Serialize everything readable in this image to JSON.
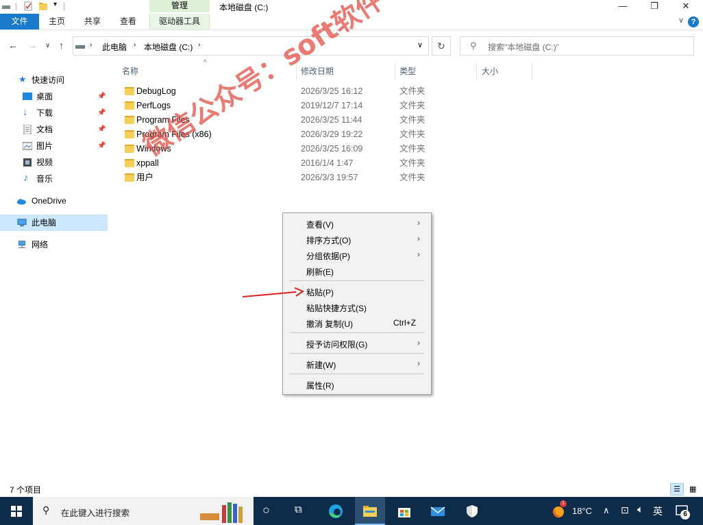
{
  "window": {
    "title": "本地磁盘 (C:)",
    "manage_tab": "管理",
    "controls": {
      "minimize": "—",
      "maximize": "❐",
      "close": "✕"
    }
  },
  "ribbon": {
    "tabs": [
      {
        "label": "文件",
        "active": true
      },
      {
        "label": "主页"
      },
      {
        "label": "共享"
      },
      {
        "label": "查看"
      },
      {
        "label": "驱动器工具"
      }
    ],
    "accent_color": "#1979ca"
  },
  "address": {
    "breadcrumb": [
      "此电脑",
      "本地磁盘 (C:)"
    ],
    "search_placeholder": "搜索\"本地磁盘 (C:)\""
  },
  "nav": {
    "quick_access": "快速访问",
    "pinned": [
      {
        "label": "桌面",
        "icon": "desktop-icon",
        "pinned": true
      },
      {
        "label": "下载",
        "icon": "download-icon",
        "pinned": true
      },
      {
        "label": "文档",
        "icon": "document-icon",
        "pinned": true
      },
      {
        "label": "图片",
        "icon": "picture-icon",
        "pinned": true
      },
      {
        "label": "视频",
        "icon": "video-icon",
        "pinned": false
      },
      {
        "label": "音乐",
        "icon": "music-icon",
        "pinned": false
      }
    ],
    "onedrive": "OneDrive",
    "this_pc": "此电脑",
    "network": "网络"
  },
  "columns": {
    "name": "名称",
    "modified": "修改日期",
    "type": "类型",
    "size": "大小"
  },
  "files": [
    {
      "name": "DebugLog",
      "modified": "2026/3/25 16:12",
      "type": "文件夹"
    },
    {
      "name": "PerfLogs",
      "modified": "2019/12/7 17:14",
      "type": "文件夹"
    },
    {
      "name": "Program Files",
      "modified": "2026/3/25 11:44",
      "type": "文件夹"
    },
    {
      "name": "Program Files (x86)",
      "modified": "2026/3/29 19:22",
      "type": "文件夹"
    },
    {
      "name": "Windows",
      "modified": "2026/3/25 16:09",
      "type": "文件夹"
    },
    {
      "name": "xppall",
      "modified": "2016/1/4 1:47",
      "type": "文件夹"
    },
    {
      "name": "用户",
      "modified": "2026/3/3 19:57",
      "type": "文件夹"
    }
  ],
  "context_menu": {
    "items": [
      {
        "label": "查看(V)",
        "submenu": true
      },
      {
        "label": "排序方式(O)",
        "submenu": true
      },
      {
        "label": "分组依据(P)",
        "submenu": true
      },
      {
        "label": "刷新(E)"
      },
      {
        "label": "粘贴(P)"
      },
      {
        "label": "粘贴快捷方式(S)"
      },
      {
        "label": "撤消 复制(U)",
        "shortcut": "Ctrl+Z"
      },
      {
        "label": "授予访问权限(G)",
        "submenu": true
      },
      {
        "label": "新建(W)",
        "submenu": true
      },
      {
        "label": "属性(R)"
      }
    ]
  },
  "status": {
    "item_count": "7 个项目"
  },
  "taskbar": {
    "search_placeholder": "在此键入进行搜索",
    "weather": "18°C",
    "ime": "英",
    "notification_count": "6",
    "weather_badge": "1"
  },
  "watermark": "微信公众号：soft软件"
}
